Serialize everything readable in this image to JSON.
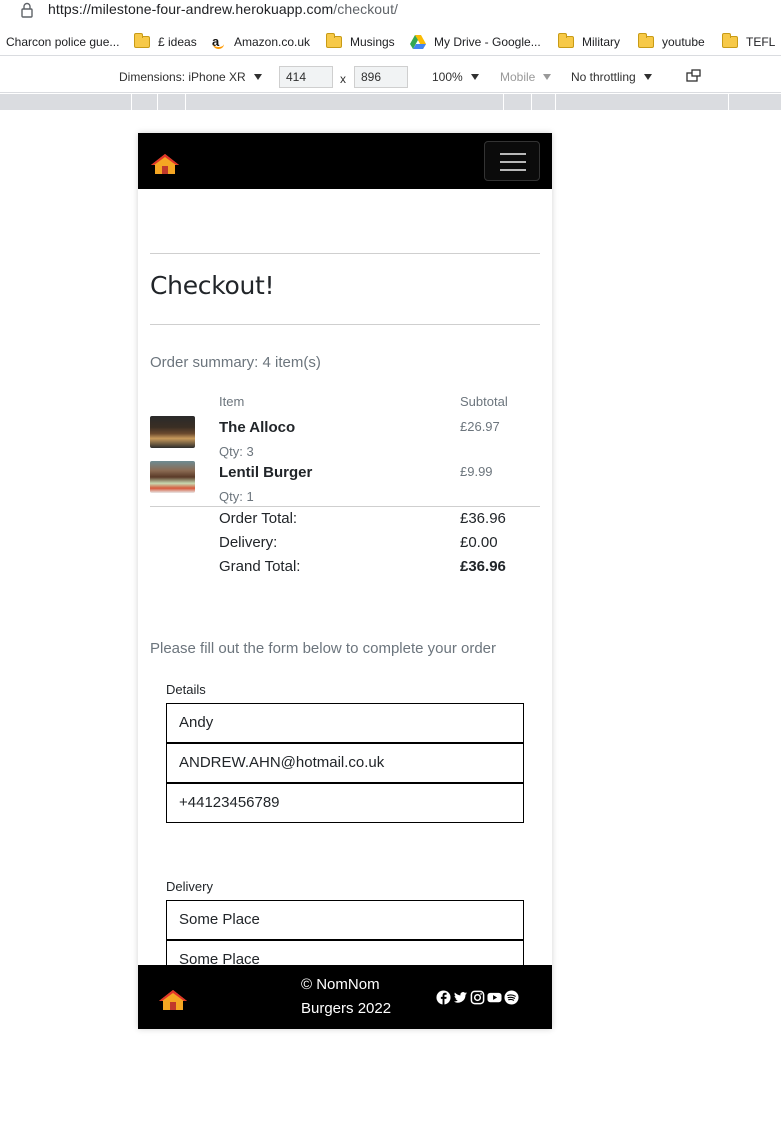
{
  "browser": {
    "url_main": "https://milestone-four-andrew.herokuapp.com",
    "url_path": "/checkout/",
    "bookmarks": [
      {
        "label": "Charcon police gue...",
        "icon": "none"
      },
      {
        "label": "£ ideas",
        "icon": "folder-icon"
      },
      {
        "label": "Amazon.co.uk",
        "icon": "amazon-icon"
      },
      {
        "label": "Musings",
        "icon": "folder-icon"
      },
      {
        "label": "My Drive - Google...",
        "icon": "google-drive-icon"
      },
      {
        "label": "Military",
        "icon": "folder-icon"
      },
      {
        "label": "youtube",
        "icon": "folder-icon"
      },
      {
        "label": "TEFL",
        "icon": "folder-icon"
      }
    ]
  },
  "devtools": {
    "dimensions_label": "Dimensions: iPhone XR",
    "width": "414",
    "separator": "x",
    "height": "896",
    "zoom": "100%",
    "device_type": "Mobile",
    "throttling": "No throttling"
  },
  "site": {
    "page_title": "Checkout!",
    "order_summary": "Order summary: 4 item(s)",
    "table_headers": {
      "item": "Item",
      "subtotal": "Subtotal"
    },
    "items": [
      {
        "name": "The Alloco",
        "qty": "Qty: 3",
        "subtotal": "£26.97"
      },
      {
        "name": "Lentil Burger",
        "qty": "Qty: 1",
        "subtotal": "£9.99"
      }
    ],
    "totals": {
      "order_total_label": "Order Total:",
      "order_total": "£36.96",
      "delivery_label": "Delivery:",
      "delivery": "£0.00",
      "grand_total_label": "Grand Total:",
      "grand_total": "£36.96"
    },
    "form_intro": "Please fill out the form below to complete your order",
    "details_legend": "Details",
    "details_fields": [
      "Andy",
      "ANDREW.AHN@hotmail.co.uk",
      "+44123456789"
    ],
    "delivery_legend": "Delivery",
    "delivery_fields": [
      "Some Place",
      "Some Place"
    ],
    "footer_line1": "© NomNom",
    "footer_line2": "Burgers 2022",
    "colors": {
      "navbar": "#000000",
      "logo_orange": "#f5a623",
      "logo_red": "#e0342a"
    }
  }
}
